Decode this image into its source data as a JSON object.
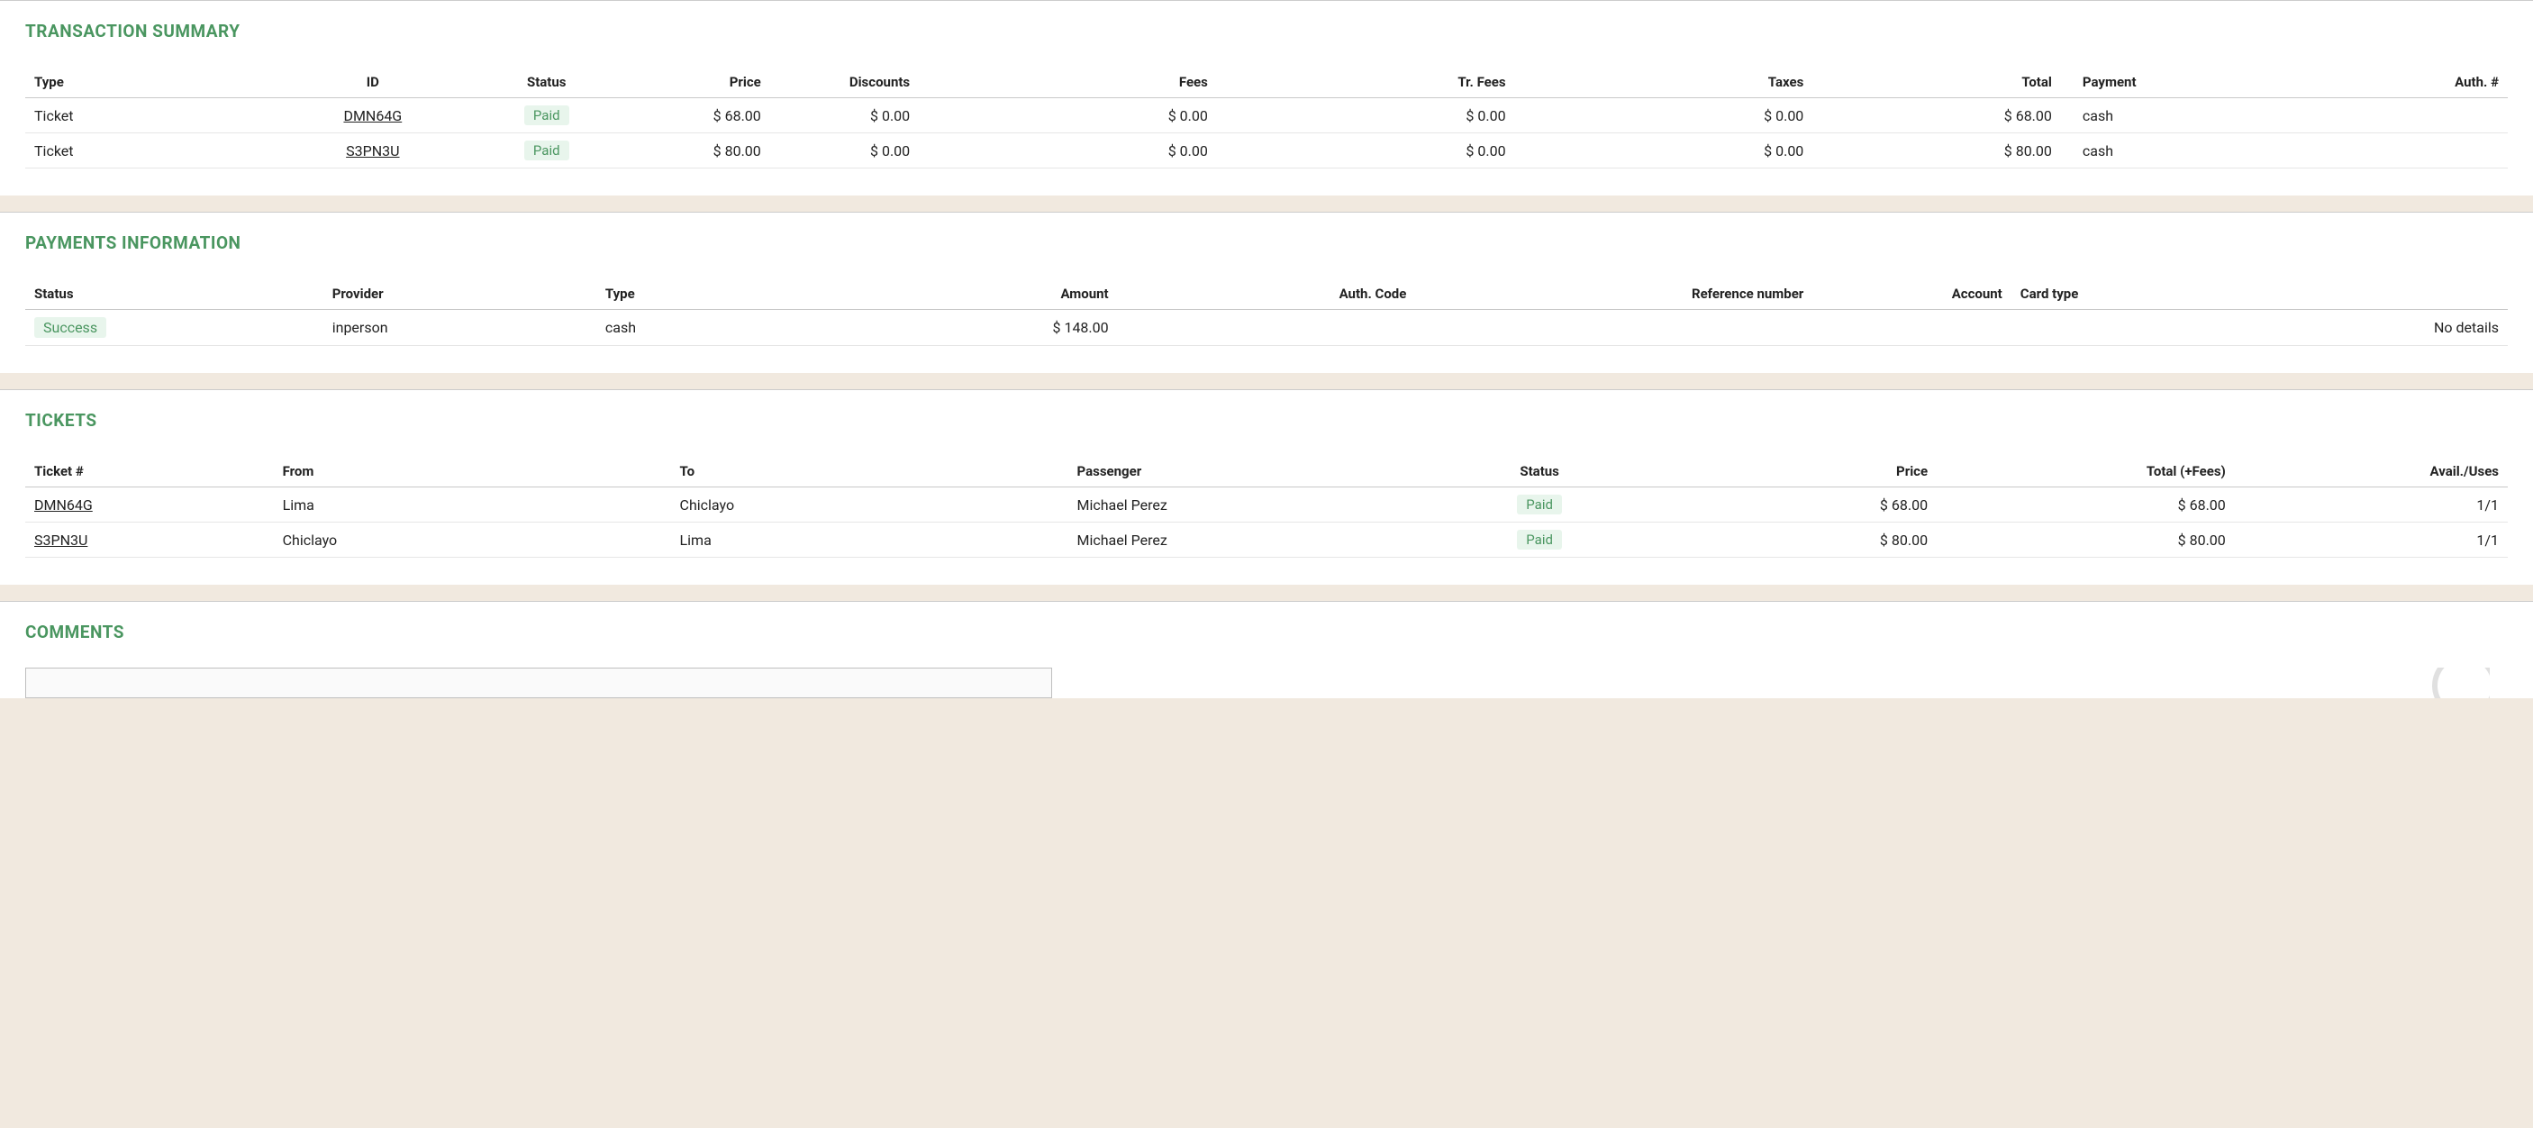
{
  "sections": {
    "transaction_summary_title": "Transaction Summary",
    "payments_info_title": "Payments Information",
    "tickets_title": "Tickets",
    "comments_title": "Comments"
  },
  "transaction_summary": {
    "headers": {
      "type": "Type",
      "id": "ID",
      "status": "Status",
      "price": "Price",
      "discounts": "Discounts",
      "fees": "Fees",
      "tr_fees": "Tr. Fees",
      "taxes": "Taxes",
      "total": "Total",
      "payment": "Payment",
      "auth_no": "Auth. #"
    },
    "rows": [
      {
        "type": "Ticket",
        "id": "DMN64G",
        "status": "Paid",
        "price": "$ 68.00",
        "discounts": "$ 0.00",
        "fees": "$ 0.00",
        "tr_fees": "$ 0.00",
        "taxes": "$ 0.00",
        "total": "$ 68.00",
        "payment": "cash",
        "auth_no": ""
      },
      {
        "type": "Ticket",
        "id": "S3PN3U",
        "status": "Paid",
        "price": "$ 80.00",
        "discounts": "$ 0.00",
        "fees": "$ 0.00",
        "tr_fees": "$ 0.00",
        "taxes": "$ 0.00",
        "total": "$ 80.00",
        "payment": "cash",
        "auth_no": ""
      }
    ]
  },
  "payments": {
    "headers": {
      "status": "Status",
      "provider": "Provider",
      "type": "Type",
      "amount": "Amount",
      "auth_code": "Auth. Code",
      "reference": "Reference number",
      "account": "Account",
      "card_type": "Card type",
      "details": ""
    },
    "rows": [
      {
        "status": "Success",
        "provider": "inperson",
        "type": "cash",
        "amount": "$ 148.00",
        "auth_code": "",
        "reference": "",
        "account": "",
        "card_type": "",
        "details": "No details"
      }
    ]
  },
  "tickets": {
    "headers": {
      "ticket_no": "Ticket #",
      "from": "From",
      "to": "To",
      "passenger": "Passenger",
      "status": "Status",
      "price": "Price",
      "total_fees": "Total (+Fees)",
      "avail_uses": "Avail./Uses"
    },
    "rows": [
      {
        "ticket_no": "DMN64G",
        "from": "Lima",
        "to": "Chiclayo",
        "passenger": "Michael Perez",
        "status": "Paid",
        "price": "$ 68.00",
        "total_fees": "$ 68.00",
        "avail_uses": "1/1"
      },
      {
        "ticket_no": "S3PN3U",
        "from": "Chiclayo",
        "to": "Lima",
        "passenger": "Michael Perez",
        "status": "Paid",
        "price": "$ 80.00",
        "total_fees": "$ 80.00",
        "avail_uses": "1/1"
      }
    ]
  },
  "comments": {
    "placeholder": ""
  }
}
